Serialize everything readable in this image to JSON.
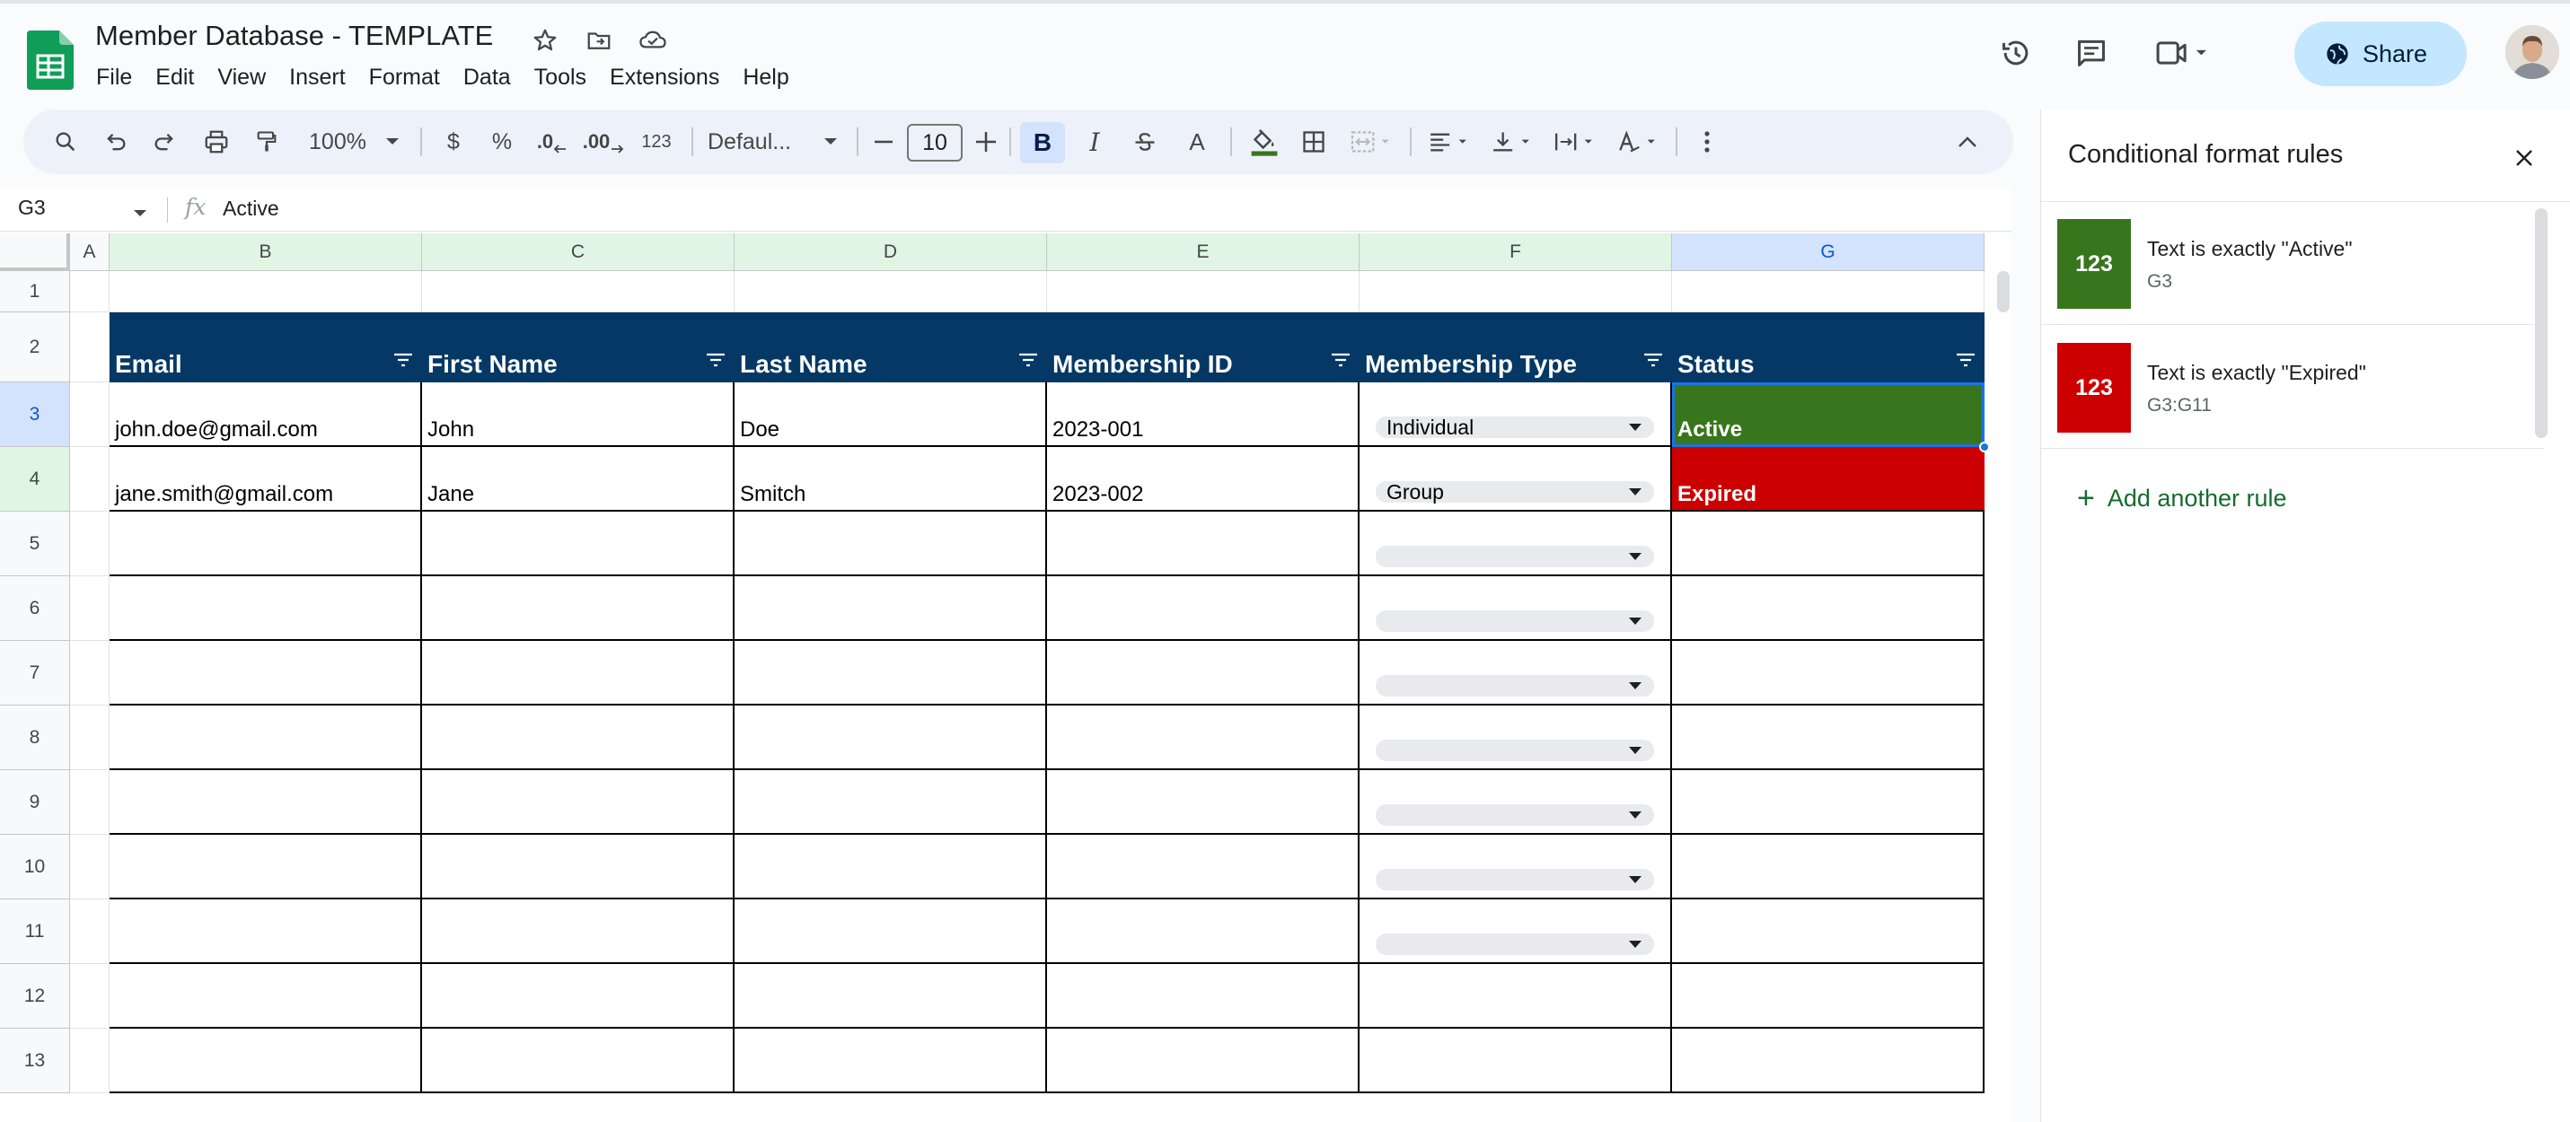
{
  "app": {
    "doc_title": "Member Database - TEMPLATE",
    "menu": [
      "File",
      "Edit",
      "View",
      "Insert",
      "Format",
      "Data",
      "Tools",
      "Extensions",
      "Help"
    ],
    "share_label": "Share"
  },
  "toolbar": {
    "zoom": "100%",
    "currency": "$",
    "percent": "%",
    "dec_decrease": ".0",
    "dec_increase": ".00",
    "number_format": "123",
    "font": "Defaul...",
    "font_size": "10",
    "bold": "B",
    "italic": "I",
    "text_color": "A"
  },
  "formula_bar": {
    "cell_ref": "G3",
    "fx": "fx",
    "value": "Active"
  },
  "grid": {
    "columns": [
      "A",
      "B",
      "C",
      "D",
      "E",
      "F",
      "G"
    ],
    "rows": [
      "1",
      "2",
      "3",
      "4",
      "5",
      "6",
      "7",
      "8",
      "9",
      "10",
      "11",
      "12",
      "13"
    ],
    "headers": {
      "email": "Email",
      "first_name": "First Name",
      "last_name": "Last Name",
      "membership_id": "Membership ID",
      "membership_type": "Membership Type",
      "status": "Status"
    },
    "records": [
      {
        "email": "john.doe@gmail.com",
        "first_name": "John",
        "last_name": "Doe",
        "membership_id": "2023-001",
        "membership_type": "Individual",
        "status": "Active"
      },
      {
        "email": "jane.smith@gmail.com",
        "first_name": "Jane",
        "last_name": "Smitch",
        "membership_id": "2023-002",
        "membership_type": "Group",
        "status": "Expired"
      }
    ],
    "colors": {
      "header_bg": "#053865",
      "active": "#38761d",
      "expired": "#cc0000"
    }
  },
  "panel": {
    "title": "Conditional format rules",
    "rules": [
      {
        "preview": "123",
        "condition": "Text is exactly \"Active\"",
        "range": "G3",
        "color": "#38761d"
      },
      {
        "preview": "123",
        "condition": "Text is exactly \"Expired\"",
        "range": "G3:G11",
        "color": "#cc0000"
      }
    ],
    "add_rule": "Add another rule"
  }
}
